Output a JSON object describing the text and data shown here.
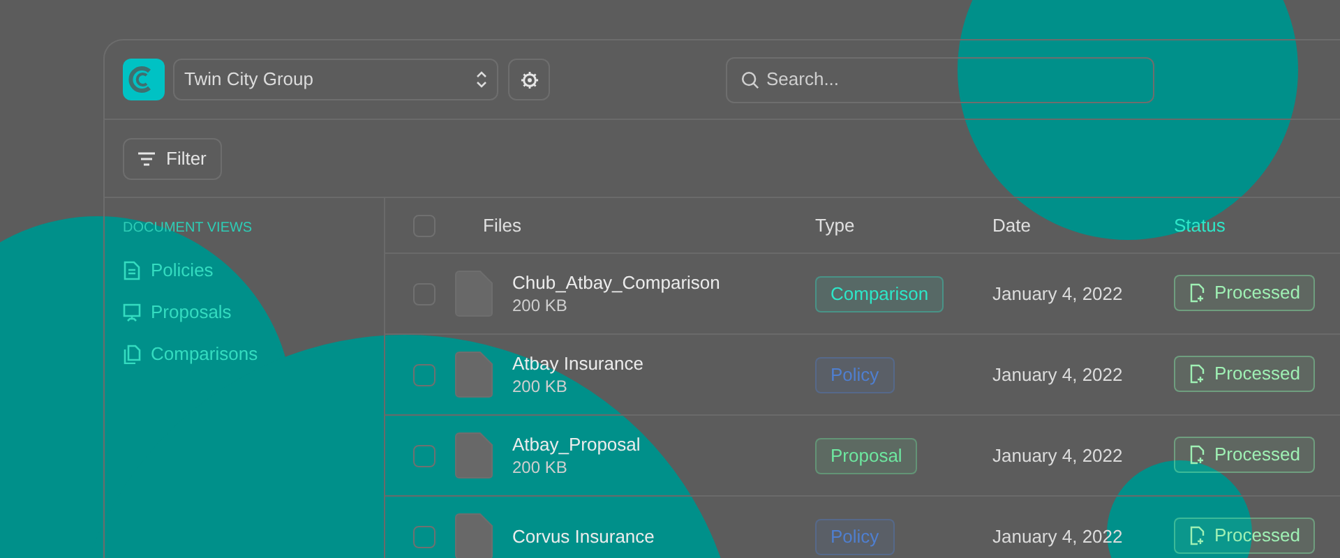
{
  "workspace": {
    "name": "Twin City Group"
  },
  "search": {
    "placeholder": "Search..."
  },
  "filter_button": {
    "label": "Filter"
  },
  "sidebar": {
    "heading": "DOCUMENT VIEWS",
    "items": [
      {
        "label": "Policies",
        "kind": "document"
      },
      {
        "label": "Proposals",
        "kind": "presentation"
      },
      {
        "label": "Comparisons",
        "kind": "copies"
      }
    ]
  },
  "table": {
    "header_checkbox": {
      "checked": false
    },
    "columns": [
      "Files",
      "Type",
      "Date",
      "Status"
    ],
    "rows": [
      {
        "checked": false,
        "name": "Chub_Atbay_Comparison",
        "size": "200 KB",
        "type": {
          "label": "Comparison",
          "color": "#2ee6c8"
        },
        "date": "January 4, 2022",
        "status": "Processed"
      },
      {
        "checked": false,
        "name": "Atbay Insurance",
        "size": "200 KB",
        "type": {
          "label": "Policy",
          "color": "#4f7fd0"
        },
        "date": "January 4, 2022",
        "status": "Processed"
      },
      {
        "checked": false,
        "name": "Atbay_Proposal",
        "size": "200 KB",
        "type": {
          "label": "Proposal",
          "color": "#6ee7a0"
        },
        "date": "January 4, 2022",
        "status": "Processed"
      },
      {
        "checked": false,
        "name": "Corvus Insurance",
        "type": {
          "label": "Policy",
          "color": "#4f7fd0"
        },
        "date": "January 4, 2022",
        "status": "Processed"
      }
    ]
  }
}
